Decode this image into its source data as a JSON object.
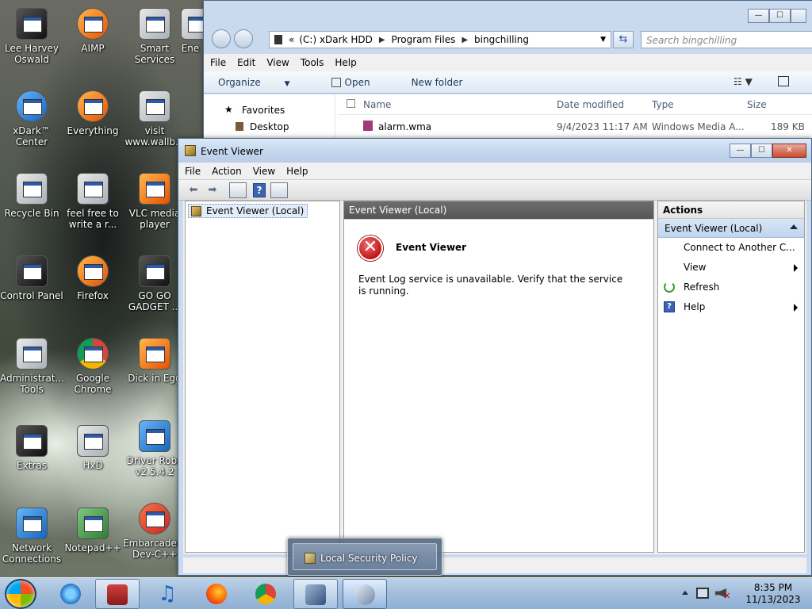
{
  "desktop": {
    "icons": [
      {
        "label": "Lee Harvey Oswald"
      },
      {
        "label": "AIMP"
      },
      {
        "label": "Smart Services"
      },
      {
        "label": "Ene"
      },
      {
        "label": "xDark™ Center"
      },
      {
        "label": "Everything"
      },
      {
        "label": "visit www.wallb..."
      },
      {
        "label": "Recycle Bin"
      },
      {
        "label": "feel free to write a r..."
      },
      {
        "label": "VLC media player"
      },
      {
        "label": "Control Panel"
      },
      {
        "label": "Firefox"
      },
      {
        "label": "GO GO GADGET ..."
      },
      {
        "label": "Administrat... Tools"
      },
      {
        "label": "Google Chrome"
      },
      {
        "label": "Dick in Egg"
      },
      {
        "label": "Extras"
      },
      {
        "label": "HxD"
      },
      {
        "label": "Driver Robo v2.5.4.2"
      },
      {
        "label": "Network Connections"
      },
      {
        "label": "Notepad++"
      },
      {
        "label": "Embarcadero Dev-C++"
      }
    ]
  },
  "explorer": {
    "address": {
      "prefix": "«",
      "segments": [
        "(C:) xDark HDD",
        "Program Files",
        "bingchilling"
      ]
    },
    "search_placeholder": "Search bingchilling",
    "menu": [
      "File",
      "Edit",
      "View",
      "Tools",
      "Help"
    ],
    "commands": {
      "organize": "Organize",
      "open": "Open",
      "new_folder": "New folder"
    },
    "nav": {
      "favorites": "Favorites",
      "desktop": "Desktop"
    },
    "columns": {
      "name": "Name",
      "date": "Date modified",
      "type": "Type",
      "size": "Size"
    },
    "files": [
      {
        "name": "alarm.wma",
        "date": "9/4/2023 11:17 AM",
        "type": "Windows Media A...",
        "size": "189 KB"
      }
    ]
  },
  "eventviewer": {
    "title": "Event Viewer",
    "menu": [
      "File",
      "Action",
      "View",
      "Help"
    ],
    "tree_root": "Event Viewer (Local)",
    "center_header": "Event Viewer (Local)",
    "error_title": "Event Viewer",
    "error_message": "Event Log service is unavailable. Verify that the service is running.",
    "actions": {
      "header": "Actions",
      "section": "Event Viewer (Local)",
      "items": [
        {
          "label": "Connect to Another C..."
        },
        {
          "label": "View"
        },
        {
          "label": "Refresh"
        },
        {
          "label": "Help"
        }
      ]
    }
  },
  "taskbar": {
    "popup_label": "Local Security Policy",
    "clock": {
      "time": "8:35 PM",
      "date": "11/13/2023"
    }
  },
  "icons": {
    "start": "windows-orb",
    "error": "error-x-icon",
    "refresh": "refresh-icon",
    "help": "help-icon"
  },
  "colors": {
    "taskbar": "#a4bfdc",
    "titlebar": "#c6d8ee",
    "error_red": "#c01515",
    "center_header": "#6d6d6d"
  }
}
